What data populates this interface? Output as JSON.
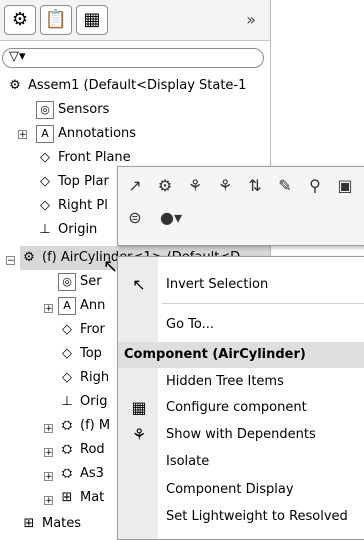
{
  "tabs": [
    {
      "icon": "feature-manager-icon",
      "glyph": "⚙"
    },
    {
      "icon": "property-manager-icon",
      "glyph": "📋"
    },
    {
      "icon": "configuration-manager-icon",
      "glyph": "▦"
    }
  ],
  "expand_label": "»",
  "filter_glyph": "▽▾",
  "tree": {
    "root": "Assem1  (Default<Display State-1",
    "items": [
      {
        "label": "Sensors",
        "icon": "sensors-icon",
        "glyph": "◎"
      },
      {
        "label": "Annotations",
        "icon": "annotations-icon",
        "glyph": "A"
      },
      {
        "label": "Front Plane",
        "icon": "plane-icon",
        "glyph": "◇"
      },
      {
        "label": "Top Plar",
        "icon": "plane-icon",
        "glyph": "◇"
      },
      {
        "label": "Right Pl",
        "icon": "plane-icon",
        "glyph": "◇"
      },
      {
        "label": "Origin",
        "icon": "origin-icon",
        "glyph": "⊥"
      }
    ],
    "component": "(f) AirCylinder<1> (Default<D",
    "sub_items": [
      {
        "label": "Ser",
        "icon": "sensors-icon",
        "glyph": "◎"
      },
      {
        "label": "Ann",
        "icon": "annotations-icon",
        "glyph": "A"
      },
      {
        "label": "Fror",
        "icon": "plane-icon",
        "glyph": "◇"
      },
      {
        "label": "Top",
        "icon": "plane-icon",
        "glyph": "◇"
      },
      {
        "label": "Righ",
        "icon": "plane-icon",
        "glyph": "◇"
      },
      {
        "label": "Orig",
        "icon": "origin-icon",
        "glyph": "⊥"
      },
      {
        "label": "(f) M",
        "icon": "part-icon",
        "glyph": "⛭"
      },
      {
        "label": "Rod",
        "icon": "part-icon",
        "glyph": "⛭"
      },
      {
        "label": "As3",
        "icon": "part-icon",
        "glyph": "⛭"
      },
      {
        "label": "Mat",
        "icon": "mates-icon",
        "glyph": "⊞"
      }
    ],
    "mates": "Mates"
  },
  "context_toolbar": {
    "row1": [
      "↗",
      "⚙",
      "⚘",
      "⚘",
      "⇅",
      "✎",
      "⚲",
      "▣"
    ],
    "row2": [
      "⊜",
      "●▾"
    ]
  },
  "menu": {
    "invert_selection": "Invert Selection",
    "go_to": "Go To...",
    "header": "Component (AirCylinder)",
    "hidden_tree_items": "Hidden Tree Items",
    "configure_component": "Configure component",
    "show_with_dependents": "Show with Dependents",
    "isolate": "Isolate",
    "component_display": "Component Display",
    "set_lightweight": "Set Lightweight to Resolved"
  }
}
